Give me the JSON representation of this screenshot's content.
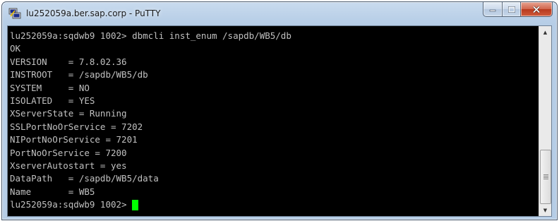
{
  "window": {
    "title": "lu252059a.ber.sap.corp - PuTTY",
    "app_icon": "putty-icon",
    "buttons": {
      "minimize_icon": "minimize-icon",
      "maximize_icon": "maximize-icon",
      "close_icon": "close-icon"
    }
  },
  "terminal": {
    "lines": [
      "lu252059a:sqdwb9 1002> dbmcli inst_enum /sapdb/WB5/db",
      "OK",
      "VERSION    = 7.8.02.36",
      "INSTROOT   = /sapdb/WB5/db",
      "SYSTEM     = NO",
      "ISOLATED   = YES",
      "XServerState = Running",
      "SSLPortNoOrService = 7202",
      "NIPortNoOrService = 7201",
      "PortNoOrService = 7200",
      "XserverAutostart = yes",
      "DataPath   = /sapdb/WB5/data",
      "Name       = WB5",
      "lu252059a:sqdwb9 1002> "
    ],
    "colors": {
      "background": "#000000",
      "foreground": "#c0c0c0",
      "cursor": "#00ff00"
    }
  },
  "scrollbar": {
    "up_icon": "arrow-up-icon",
    "down_icon": "arrow-down-icon"
  }
}
